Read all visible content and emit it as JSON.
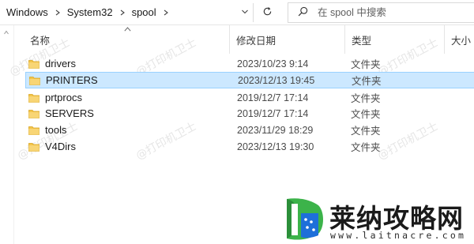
{
  "address_bar": {
    "breadcrumbs": [
      "Windows",
      "System32",
      "spool"
    ],
    "separator_icon": "chevron-right-icon",
    "dropdown_icon": "chevron-down-icon",
    "refresh_icon": "refresh-icon"
  },
  "search": {
    "placeholder": "在 spool 中搜索",
    "icon": "search-icon"
  },
  "columns": {
    "name": "名称",
    "date": "修改日期",
    "type": "类型",
    "size": "大小"
  },
  "files": [
    {
      "name": "drivers",
      "date": "2023/10/23 9:14",
      "type": "文件夹",
      "selected": false
    },
    {
      "name": "PRINTERS",
      "date": "2023/12/13 19:45",
      "type": "文件夹",
      "selected": true
    },
    {
      "name": "prtprocs",
      "date": "2019/12/7 17:14",
      "type": "文件夹",
      "selected": false
    },
    {
      "name": "SERVERS",
      "date": "2019/12/7 17:14",
      "type": "文件夹",
      "selected": false
    },
    {
      "name": "tools",
      "date": "2023/11/29 18:29",
      "type": "文件夹",
      "selected": false
    },
    {
      "name": "V4Dirs",
      "date": "2023/12/13 19:30",
      "type": "文件夹",
      "selected": false
    }
  ],
  "watermark": "@打印机卫士",
  "brand": {
    "title": "莱纳攻略网",
    "url": "www.laitnacre.com"
  },
  "colors": {
    "selection_bg": "#cce8ff",
    "selection_border": "#99d1ff",
    "folder": "#f3c44a",
    "brand_green": "#3cb34a",
    "brand_blue": "#1e6fd9"
  }
}
